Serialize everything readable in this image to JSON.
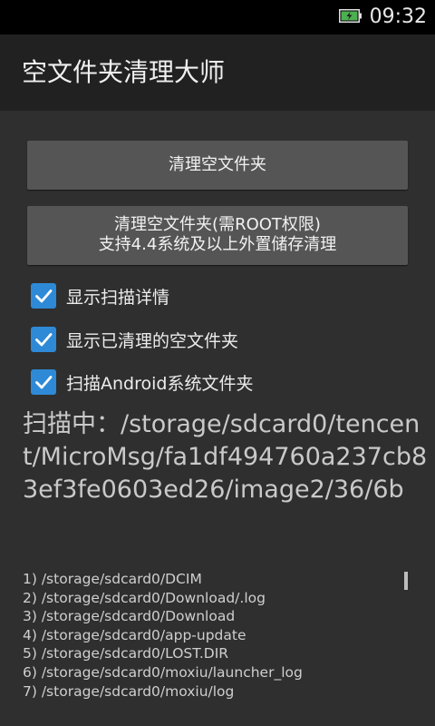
{
  "status_bar": {
    "time": "09:32",
    "battery_icon": "battery-charging-icon"
  },
  "app": {
    "title": "空文件夹清理大师"
  },
  "buttons": {
    "clean_empty_folders": "清理空文件夹",
    "clean_root_line1": "清理空文件夹(需ROOT权限)",
    "clean_root_line2": "支持4.4系统及以上外置储存清理"
  },
  "options": [
    {
      "label": "显示扫描详情",
      "checked": true
    },
    {
      "label": "显示已清理的空文件夹",
      "checked": true
    },
    {
      "label": "扫描Android系统文件夹",
      "checked": true
    }
  ],
  "scan": {
    "status_text": "扫描中：/storage/sdcard0/tencent/MicroMsg/fa1df494760a237cb83ef3fe0603ed26/image2/36/6b"
  },
  "log": [
    "1) /storage/sdcard0/DCIM",
    "2) /storage/sdcard0/Download/.log",
    "3) /storage/sdcard0/Download",
    "4) /storage/sdcard0/app-update",
    "5) /storage/sdcard0/LOST.DIR",
    "6) /storage/sdcard0/moxiu/launcher_log",
    "7) /storage/sdcard0/moxiu/log"
  ],
  "colors": {
    "checkbox_accent": "#2e8ad6",
    "battery_green": "#4caf50",
    "action_bar": "#212121",
    "button": "#555555"
  }
}
